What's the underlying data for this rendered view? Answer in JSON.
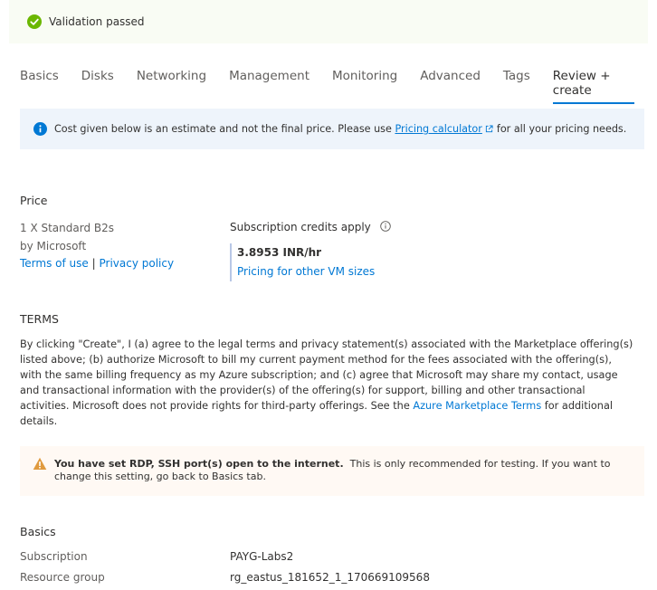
{
  "validation": {
    "text": "Validation passed"
  },
  "tabs": [
    {
      "label": "Basics"
    },
    {
      "label": "Disks"
    },
    {
      "label": "Networking"
    },
    {
      "label": "Management"
    },
    {
      "label": "Monitoring"
    },
    {
      "label": "Advanced"
    },
    {
      "label": "Tags"
    },
    {
      "label": "Review + create"
    }
  ],
  "info": {
    "prefix": "Cost given below is an estimate and not the final price. Please use ",
    "link": "Pricing calculator",
    "suffix": "for all your pricing needs."
  },
  "price": {
    "title": "Price",
    "product": "1 X Standard B2s",
    "publisher": "by Microsoft",
    "terms_of_use": "Terms of use",
    "separator": "|",
    "privacy_policy": "Privacy policy",
    "credits_label": "Subscription credits apply",
    "value": "3.8953 INR/hr",
    "other_sizes_link": "Pricing for other VM sizes"
  },
  "terms": {
    "title": "TERMS",
    "text_before": "By clicking \"Create\", I (a) agree to the legal terms and privacy statement(s) associated with the Marketplace offering(s) listed above; (b) authorize Microsoft to bill my current payment method for the fees associated with the offering(s), with the same billing frequency as my Azure subscription; and (c) agree that Microsoft may share my contact, usage and transactional information with the provider(s) of the offering(s) for support, billing and other transactional activities. Microsoft does not provide rights for third-party offerings. See the ",
    "link": "Azure Marketplace Terms",
    "text_after": " for additional details."
  },
  "warning": {
    "bold": "You have set RDP, SSH port(s) open to the internet.",
    "text": "This is only recommended for testing.  If you want to change this setting, go back to Basics tab."
  },
  "basics": {
    "title": "Basics",
    "subscription_label": "Subscription",
    "subscription_value": "PAYG-Labs2",
    "resource_group_label": "Resource group",
    "resource_group_value": "rg_eastus_181652_1_170669109568"
  },
  "colors": {
    "accent": "#0078d4",
    "success": "#6bb700",
    "warning": "#e09a3e"
  }
}
